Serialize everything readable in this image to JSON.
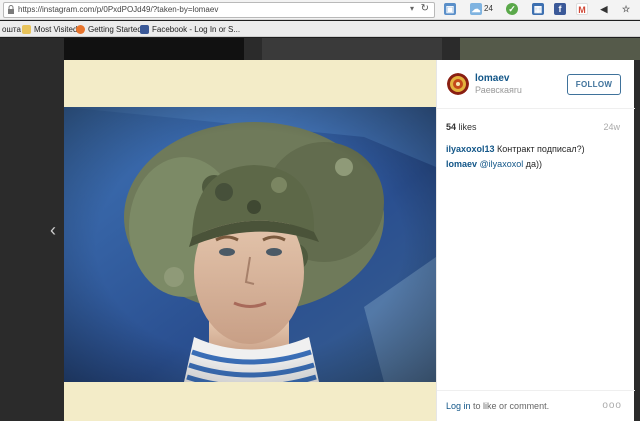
{
  "browser": {
    "url": "https://instagram.com/p/0PxdPOJd49/?taken-by=lomaev",
    "weather_temp": "24",
    "bookmarks": [
      {
        "label": "ошта"
      },
      {
        "label": "Most Visited"
      },
      {
        "label": "Getting Started"
      },
      {
        "label": "Facebook - Log In or S..."
      }
    ]
  },
  "post": {
    "username": "lomaev",
    "location": "Раевскаяru",
    "follow_label": "FOLLOW",
    "likes_count": "54",
    "likes_label": "likes",
    "age": "24w",
    "comments": [
      {
        "user": "ilyaxoxol13",
        "text": "Контракт подписал?)"
      },
      {
        "user": "lomaev",
        "mention": "@ilyaxoxol",
        "text": "да))"
      }
    ],
    "login_link": "Log in",
    "login_text": "to like or comment.",
    "more_label": "ooo"
  },
  "colors": {
    "accent": "#3f729b",
    "username": "#125688"
  }
}
